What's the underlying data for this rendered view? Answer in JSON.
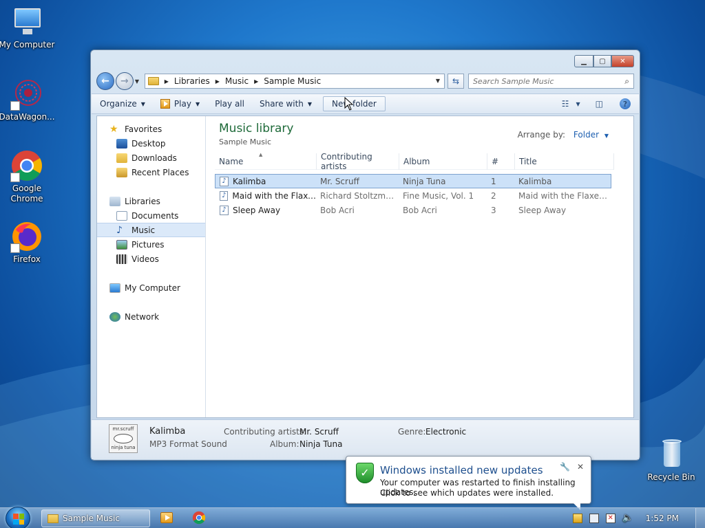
{
  "desktop": {
    "icons": [
      {
        "label": "My Computer"
      },
      {
        "label": "DataWagon..."
      },
      {
        "label": "Google Chrome"
      },
      {
        "label": "Firefox"
      },
      {
        "label": "Recycle Bin"
      }
    ]
  },
  "window": {
    "breadcrumb": [
      "Libraries",
      "Music",
      "Sample Music"
    ],
    "search_placeholder": "Search Sample Music",
    "toolbar": {
      "organize": "Organize",
      "play": "Play",
      "play_all": "Play all",
      "share_with": "Share with",
      "new_folder": "New folder"
    },
    "nav": {
      "favorites": "Favorites",
      "desktop": "Desktop",
      "downloads": "Downloads",
      "recent_places": "Recent Places",
      "libraries": "Libraries",
      "documents": "Documents",
      "music": "Music",
      "pictures": "Pictures",
      "videos": "Videos",
      "my_computer": "My Computer",
      "network": "Network"
    },
    "library": {
      "title": "Music library",
      "subtitle": "Sample Music",
      "arrange_label": "Arrange by:",
      "arrange_value": "Folder"
    },
    "columns": [
      "Name",
      "Contributing artists",
      "Album",
      "#",
      "Title"
    ],
    "rows": [
      {
        "name": "Kalimba",
        "artist": "Mr. Scruff",
        "album": "Ninja Tuna",
        "num": "1",
        "title": "Kalimba"
      },
      {
        "name": "Maid with the Flaxe...",
        "artist": "Richard Stoltzman...",
        "album": "Fine Music, Vol. 1",
        "num": "2",
        "title": "Maid with the Flaxen H..."
      },
      {
        "name": "Sleep Away",
        "artist": "Bob Acri",
        "album": "Bob Acri",
        "num": "3",
        "title": "Sleep Away"
      }
    ],
    "details": {
      "art_text_top": "mr.scruff",
      "art_text_bottom": "ninja tuna",
      "title": "Kalimba",
      "type": "MP3 Format Sound",
      "artists_label": "Contributing artists:",
      "artists_value": "Mr. Scruff",
      "album_label": "Album:",
      "album_value": "Ninja Tuna",
      "genre_label": "Genre:",
      "genre_value": "Electronic"
    }
  },
  "notification": {
    "title": "Windows installed new updates",
    "line1": "Your computer was restarted to finish installing updates.",
    "line2": "Click to see which updates were installed."
  },
  "taskbar": {
    "active_window": "Sample Music",
    "clock": "1:52 PM"
  },
  "colors": {
    "library_title": "#1e6a39",
    "link_blue": "#1d5fb0",
    "selection": "#cce1f8"
  }
}
